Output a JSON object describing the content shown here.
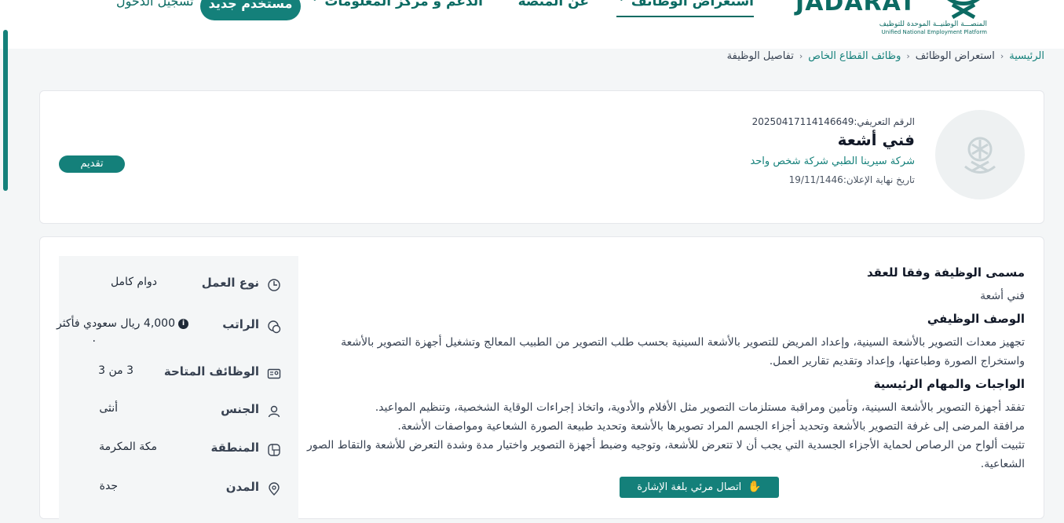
{
  "header": {
    "logo": {
      "word": "JADARAT",
      "arabic": "المنصـــة الوطنيــة الموحدة للتوظيف",
      "english": "Unified National Employment Platform"
    },
    "nav": [
      {
        "label": "استعراض الوظائف",
        "active": true,
        "has_dropdown": true
      },
      {
        "label": "عن المنصة",
        "active": false,
        "has_dropdown": false
      },
      {
        "label": "الدعم و مركز المعلومات",
        "active": false,
        "has_dropdown": true
      }
    ],
    "register_label": "مستخدم جديد",
    "login_label": "تسجيل الدخول"
  },
  "breadcrumb": {
    "items": [
      {
        "label": "الرئيسية",
        "link": true
      },
      {
        "label": "استعراض الوظائف",
        "link": false
      },
      {
        "label": "وظائف القطاع الخاص",
        "link": true
      },
      {
        "label": "تفاصيل الوظيفة",
        "link": false
      }
    ],
    "separator": "‹"
  },
  "job": {
    "ref": "الرقم التعريفي:20250417114146649",
    "title": "فني أشعة",
    "company": "شركة سيرينا الطبي شركة شخص واحد",
    "deadline": "تاريخ نهاية الإعلان:19/11/1446",
    "apply_label": "تقديم"
  },
  "details": [
    {
      "icon": "clock-icon",
      "label": "نوع العمل",
      "value": "دوام كامل"
    },
    {
      "icon": "money-icon",
      "label": "الراتب",
      "value": "4,000 ريال سعودي فأكثر"
    },
    {
      "icon": "id-card-icon",
      "label": "الوظائف المتاحة",
      "value": "3 من 3"
    },
    {
      "icon": "gender-icon",
      "label": "الجنس",
      "value": "أنثى"
    },
    {
      "icon": "region-icon",
      "label": "المنطقة",
      "value": "مكة المكرمة"
    },
    {
      "icon": "location-pin-icon",
      "label": "المدن",
      "value": "جدة"
    }
  ],
  "description": {
    "contract_title_heading": "مسمى الوظيفة وفقا للعقد",
    "contract_title": "فني أشعة",
    "job_desc_heading": "الوصف الوظيفي",
    "job_desc": "تجهيز معدات التصوير بالأشعة السينية، وإعداد المريض للتصوير بالأشعة السينية بحسب طلب التصوير من الطبيب المعالج وتشغيل أجهزة التصوير بالأشعة واستخراج الصورة وطباعتها، وإعداد وتقديم تقارير العمل.",
    "duties_heading": "الواجبات والمهام الرئيسية",
    "duties": [
      "تفقد أجهزة التصوير بالأشعة السينية، وتأمين ومراقبة مستلزمات التصوير مثل الأفلام والأدوية، واتخاذ إجراءات الوقاية الشخصية، وتنظيم المواعيد.",
      "مرافقة المرضى إلى غرفة التصوير بالأشعة وتحديد أجزاء الجسم المراد تصويرها بالأشعة وتحديد طبيعة الصورة الشعاعية ومواصفات الأشعة.",
      "تثبيت ألواح من الرصاص لحماية الأجزاء الجسدية التي يجب أن لا تتعرض للأشعة، وتوجيه وضبط أجهزة التصوير واختيار مدة وشدة التعرض للأشعة والتقاط الصور الشعاعية."
    ]
  },
  "sign_language_label": "اتصال مرئي بلغة الإشارة",
  "colors": {
    "primary": "#14807a",
    "dark_primary": "#0c6b63",
    "background": "#f4f6f7"
  }
}
